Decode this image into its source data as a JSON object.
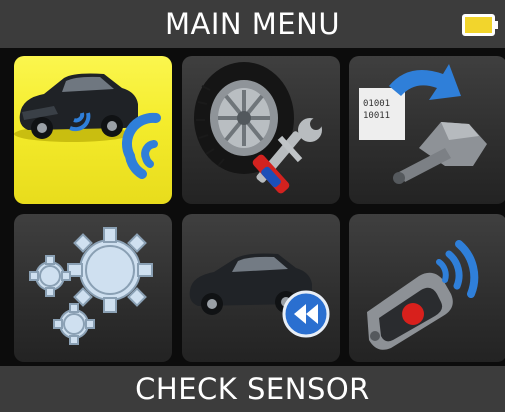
{
  "header": {
    "title": "MAIN MENU",
    "battery_icon": "battery-full-icon"
  },
  "menu": {
    "items": [
      {
        "id": "check-sensor",
        "icon": "car-sensor-signal-icon",
        "selected": true
      },
      {
        "id": "service",
        "icon": "tire-tools-icon",
        "selected": false
      },
      {
        "id": "program-sensor",
        "icon": "sensor-program-icon",
        "selected": false
      },
      {
        "id": "settings",
        "icon": "gears-icon",
        "selected": false
      },
      {
        "id": "rewind",
        "icon": "car-rewind-icon",
        "selected": false
      },
      {
        "id": "keyfob",
        "icon": "keyfob-signal-icon",
        "selected": false
      }
    ]
  },
  "footer": {
    "status": "CHECK SENSOR"
  },
  "colors": {
    "selected": "#f4ec2c",
    "tile": "#333333",
    "bar": "#3c3c3c",
    "accent_blue": "#2f7fd9"
  }
}
